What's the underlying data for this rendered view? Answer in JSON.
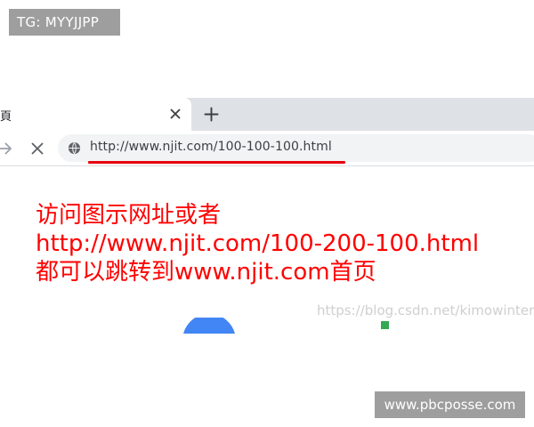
{
  "watermarks": {
    "top_left": "TG: MYYJJPP",
    "bottom_right": "www.pbcposse.com",
    "csdn": "https://blog.csdn.net/kimowinter"
  },
  "browser": {
    "tab_title": "頁",
    "new_tab_symbol": "+",
    "address_url": "http://www.njit.com/100-100-100.html",
    "icons": {
      "forward": "forward-arrow-icon",
      "stop": "stop-icon",
      "site_info": "globe-icon",
      "tab_close": "close-icon",
      "new_tab": "plus-icon"
    }
  },
  "annotation": {
    "line1": "访问图示网址或者",
    "line2": "http://www.njit.com/100-200-100.html",
    "line3": "都可以跳转到www.njit.com首页",
    "color": "#ff0000"
  },
  "colors": {
    "underline": "#e8000b",
    "google_blue": "#4285f4",
    "google_green": "#34a853"
  }
}
